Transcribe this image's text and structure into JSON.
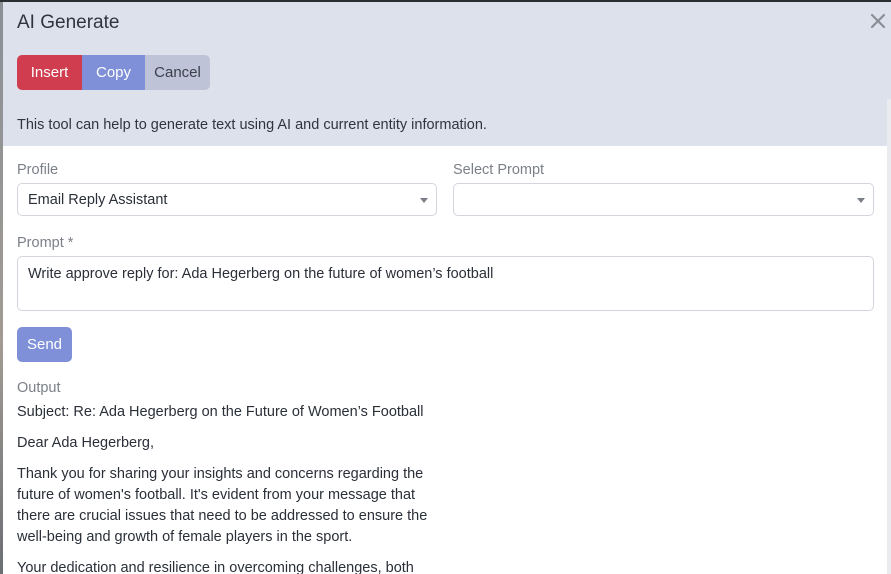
{
  "dialog": {
    "title": "AI Generate",
    "close_icon": "close-icon"
  },
  "toolbar": {
    "insert_label": "Insert",
    "copy_label": "Copy",
    "cancel_label": "Cancel"
  },
  "info_text": "This tool can help to generate text using AI and current entity information.",
  "profile": {
    "label": "Profile",
    "value": "Email Reply Assistant"
  },
  "select_prompt": {
    "label": "Select Prompt",
    "value": ""
  },
  "prompt": {
    "label": "Prompt *",
    "value": "Write approve reply for: Ada Hegerberg on the future of women’s football"
  },
  "send_label": "Send",
  "output": {
    "label": "Output",
    "paragraphs": [
      "Subject: Re: Ada Hegerberg on the Future of Women’s Football",
      "Dear Ada Hegerberg,",
      "Thank you for sharing your insights and concerns regarding the future of women's football. It's evident from your message that there are crucial issues that need to be addressed to ensure the well-being and growth of female players in the sport.",
      "Your dedication and resilience in overcoming challenges, both"
    ]
  },
  "colors": {
    "header_bg": "#dde1ec",
    "insert": "#cf3d4e",
    "copy": "#7f90d8",
    "cancel": "#bfc3d7",
    "send": "#7f90d8"
  }
}
